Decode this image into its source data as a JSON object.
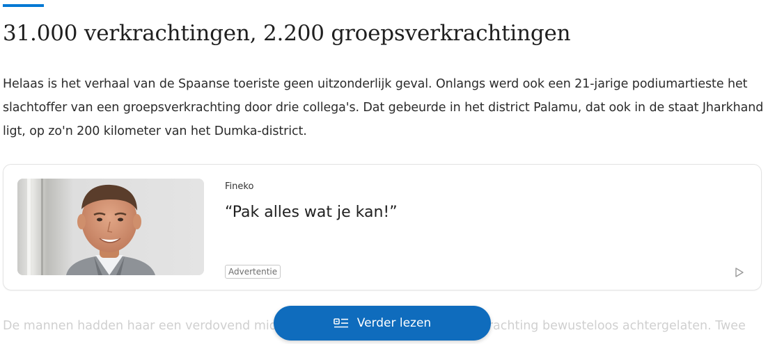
{
  "article": {
    "headline": "31.000 verkrachtingen, 2.200 groepsverkrachtingen",
    "paragraph": "Helaas is het verhaal van de Spaanse toeriste geen uitzonderlijk geval. Onlangs werd ook een 21-jarige podiumartieste het slachtoffer van een groepsverkrachting door drie collega's. Dat gebeurde in het district Palamu, dat ook in de staat Jharkhand ligt, op zo'n 200 kilometer van het Dumka-district.",
    "faded_paragraph": "De mannen hadden haar een verdovend middel toegediend en haar na de verkrachting bewusteloos achtergelaten. Twee"
  },
  "ad": {
    "source": "Fineko",
    "title": "“Pak alles wat je kan!”",
    "badge": "Advertentie",
    "choices_icon": "ad-choices-play-icon"
  },
  "read_more": {
    "label": "Verder lezen",
    "icon": "reader-list-icon"
  },
  "colors": {
    "accent": "#0078d4",
    "button": "#0f6cbd"
  }
}
